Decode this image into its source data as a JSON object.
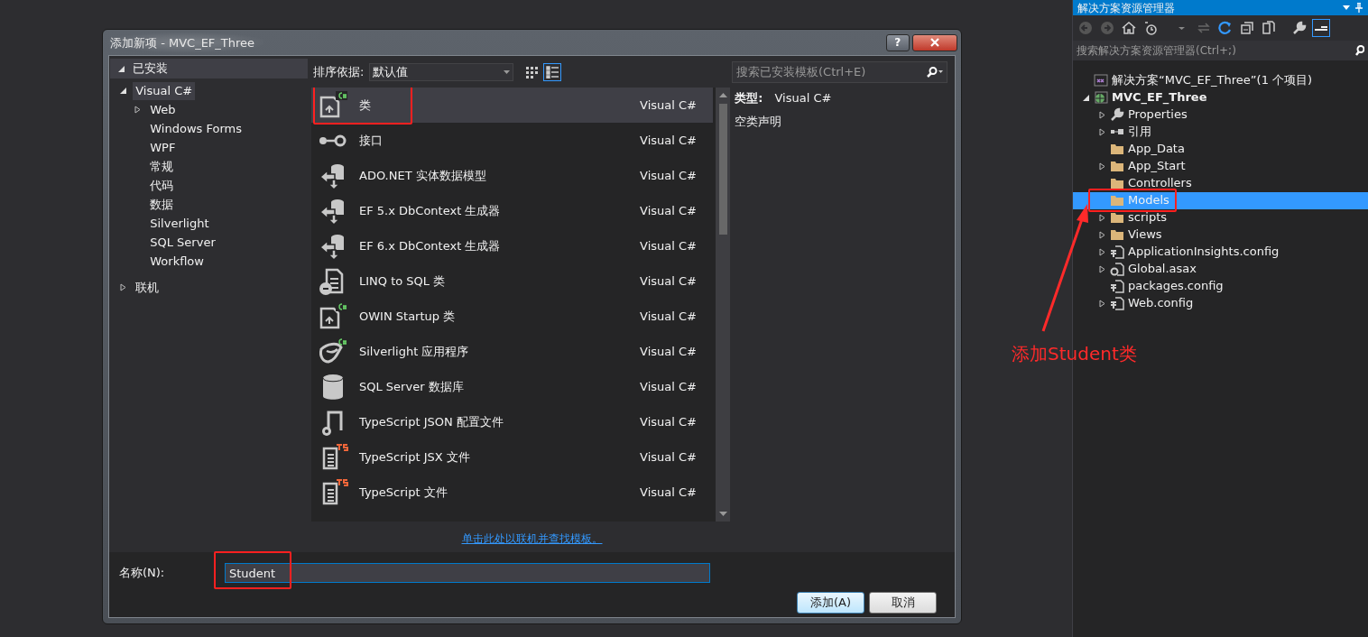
{
  "dialog": {
    "title": "添加新项 - MVC_EF_Three",
    "help_button": "?",
    "categories": {
      "header": "已安装",
      "expanded": true,
      "items": [
        {
          "label": "Visual C#",
          "expanded": true,
          "expandable": true,
          "selected": true,
          "children": [
            {
              "label": "Web",
              "expandable": true,
              "expanded": false,
              "selected": false
            },
            {
              "label": "Windows Forms",
              "expandable": false,
              "selected": false
            },
            {
              "label": "WPF",
              "expandable": false,
              "selected": false
            },
            {
              "label": "常规",
              "expandable": false,
              "selected": false
            },
            {
              "label": "代码",
              "expandable": false,
              "selected": false
            },
            {
              "label": "数据",
              "expandable": false,
              "selected": false
            },
            {
              "label": "Silverlight",
              "expandable": false,
              "selected": false
            },
            {
              "label": "SQL Server",
              "expandable": false,
              "selected": false
            },
            {
              "label": "Workflow",
              "expandable": false,
              "selected": false
            }
          ]
        },
        {
          "label": "联机",
          "expandable": true,
          "expanded": false,
          "selected": false
        }
      ]
    },
    "sort": {
      "label": "排序依据:",
      "value": "默认值"
    },
    "view_modes": [
      {
        "kind": "grid",
        "selected": false
      },
      {
        "kind": "list",
        "selected": true
      }
    ],
    "search": {
      "placeholder": "搜索已安装模板(Ctrl+E)"
    },
    "templates": [
      {
        "name": "类",
        "language": "Visual C#",
        "kind": "class",
        "selected": true,
        "highlighted": true
      },
      {
        "name": "接口",
        "language": "Visual C#",
        "kind": "interface",
        "selected": false,
        "highlighted": false
      },
      {
        "name": "ADO.NET 实体数据模型",
        "language": "Visual C#",
        "kind": "entity",
        "selected": false,
        "highlighted": false
      },
      {
        "name": "EF 5.x DbContext 生成器",
        "language": "Visual C#",
        "kind": "entity",
        "selected": false,
        "highlighted": false
      },
      {
        "name": "EF 6.x DbContext 生成器",
        "language": "Visual C#",
        "kind": "entity",
        "selected": false,
        "highlighted": false
      },
      {
        "name": "LINQ to SQL 类",
        "language": "Visual C#",
        "kind": "linq",
        "selected": false,
        "highlighted": false
      },
      {
        "name": "OWIN Startup 类",
        "language": "Visual C#",
        "kind": "class",
        "selected": false,
        "highlighted": false
      },
      {
        "name": "Silverlight 应用程序",
        "language": "Visual C#",
        "kind": "silverlight",
        "selected": false,
        "highlighted": false
      },
      {
        "name": "SQL Server 数据库",
        "language": "Visual C#",
        "kind": "database",
        "selected": false,
        "highlighted": false
      },
      {
        "name": "TypeScript JSON 配置文件",
        "language": "Visual C#",
        "kind": "json",
        "selected": false,
        "highlighted": false
      },
      {
        "name": "TypeScript JSX 文件",
        "language": "Visual C#",
        "kind": "ts",
        "selected": false,
        "highlighted": false
      },
      {
        "name": "TypeScript 文件",
        "language": "Visual C#",
        "kind": "ts",
        "selected": false,
        "highlighted": false
      }
    ],
    "details": {
      "type_label": "类型:",
      "type_value": "Visual C#",
      "description": "空类声明"
    },
    "online_link": "单击此处以联机并查找模板。",
    "name_field": {
      "label": "名称(N):",
      "value": "Student",
      "highlighted": true
    },
    "buttons": [
      {
        "label": "添加(A)",
        "kind": "primary"
      },
      {
        "label": "取消",
        "kind": "secondary"
      }
    ]
  },
  "solution_explorer": {
    "title": "解决方案资源管理器",
    "search_placeholder": "搜索解决方案资源管理器(Ctrl+;)",
    "tree": [
      {
        "label": "解决方案“MVC_EF_Three”(1 个项目)",
        "kind": "solution",
        "selected": false,
        "highlighted": false,
        "children": [
          {
            "label": "MVC_EF_Three",
            "kind": "project",
            "expandable": true,
            "expanded": true,
            "selected": false,
            "highlighted": false,
            "children": [
              {
                "label": "Properties",
                "kind": "wrench",
                "expandable": true,
                "expanded": false,
                "selected": false,
                "highlighted": false
              },
              {
                "label": "引用",
                "kind": "reference",
                "expandable": true,
                "expanded": false,
                "selected": false,
                "highlighted": false
              },
              {
                "label": "App_Data",
                "kind": "folder",
                "expandable": false,
                "selected": false,
                "highlighted": false
              },
              {
                "label": "App_Start",
                "kind": "folder",
                "expandable": true,
                "expanded": false,
                "selected": false,
                "highlighted": false
              },
              {
                "label": "Controllers",
                "kind": "folder",
                "expandable": false,
                "selected": false,
                "highlighted": false
              },
              {
                "label": "Models",
                "kind": "folder",
                "expandable": false,
                "selected": true,
                "highlighted": true
              },
              {
                "label": "scripts",
                "kind": "folder",
                "expandable": true,
                "expanded": false,
                "selected": false,
                "highlighted": false
              },
              {
                "label": "Views",
                "kind": "folder",
                "expandable": true,
                "expanded": false,
                "selected": false,
                "highlighted": false
              },
              {
                "label": "ApplicationInsights.config",
                "kind": "config",
                "expandable": true,
                "expanded": false,
                "selected": false,
                "highlighted": false
              },
              {
                "label": "Global.asax",
                "kind": "asax",
                "expandable": true,
                "expanded": false,
                "selected": false,
                "highlighted": false
              },
              {
                "label": "packages.config",
                "kind": "config",
                "expandable": false,
                "selected": false,
                "highlighted": false
              },
              {
                "label": "Web.config",
                "kind": "config",
                "expandable": true,
                "expanded": false,
                "selected": false,
                "highlighted": false
              }
            ]
          }
        ]
      }
    ]
  },
  "annotation": {
    "text": "添加Student类"
  }
}
